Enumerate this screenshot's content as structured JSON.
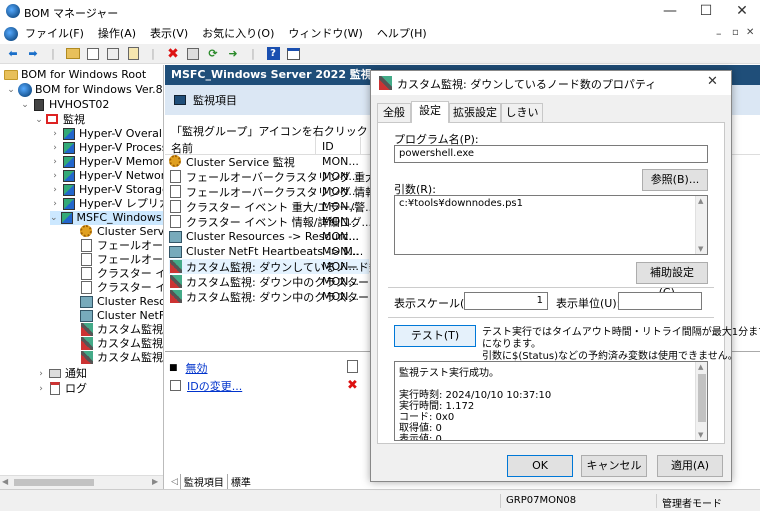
{
  "window": {
    "title": "BOM マネージャー"
  },
  "menubar": [
    "ファイル(F)",
    "操作(A)",
    "表示(V)",
    "お気に入り(O)",
    "ウィンドウ(W)",
    "ヘルプ(H)"
  ],
  "tree": {
    "root": "BOM for Windows Root",
    "version_node": "BOM for Windows Ver.8.0 (ロー",
    "host": "HVHOST02",
    "monitor": "監視",
    "groups": [
      "Hyper-V Overall he",
      "Hyper-V Processo",
      "Hyper-V Memory",
      "Hyper-V Networkin",
      "Hyper-V Storage",
      "Hyper-V レプリカ 監",
      "MSFC_Windows Se"
    ],
    "items": [
      "Cluster Service",
      "フェールオーバーク",
      "フェールオーバーク",
      "クラスター イベント",
      "クラスター イベント",
      "Cluster Resourc",
      "Cluster NetFt H",
      "カスタム監視: ダウ",
      "カスタム監視: ダウ",
      "カスタム監視: ダ"
    ],
    "notify": "通知",
    "log": "ログ"
  },
  "middle": {
    "header": "MSFC_Windows Server 2022  監視",
    "subheader": "監視項目",
    "hint": "「監視グループ」アイコンを右クリックし「新規作成」を選",
    "col_name": "名前",
    "col_id": "ID",
    "rows": [
      {
        "name": "Cluster Service 監視",
        "id": "MON..."
      },
      {
        "name": "フェールオーバークラスタリング 重大...",
        "id": "MON..."
      },
      {
        "name": "フェールオーバークラスタリング 情報...",
        "id": "MON..."
      },
      {
        "name": "クラスター イベント 重大/エラー/警...",
        "id": "MON..."
      },
      {
        "name": "クラスター イベント 情報/詳細ログ...",
        "id": "MON..."
      },
      {
        "name": "Cluster Resources -> Resourc...",
        "id": "MON..."
      },
      {
        "name": "Cluster NetFt Heartbeats -> M...",
        "id": "MON..."
      },
      {
        "name": "カスタム監視: ダウンしているノード数",
        "id": "MON..."
      },
      {
        "name": "カスタム監視: ダウン中のクラスター...",
        "id": "MON..."
      },
      {
        "name": "カスタム監視: ダウン中のクラスター...",
        "id": "MON..."
      }
    ],
    "footer_links": [
      "無効",
      "IDの変更..."
    ],
    "tabs": [
      "監視項目",
      "標準"
    ]
  },
  "dialog": {
    "title": "カスタム監視: ダウンしているノード数のプロパティ",
    "tabs": [
      "全般",
      "設定",
      "拡張設定",
      "しきい値"
    ],
    "active_tab": "設定",
    "program_label": "プログラム名(P):",
    "program_value": "powershell.exe",
    "browse_button": "参照(B)...",
    "args_label": "引数(R):",
    "args_value": "c:¥tools¥downnodes.ps1",
    "aux_button": "補助設定(C)...",
    "scale_label": "表示スケール(S):",
    "scale_value": "1",
    "unit_label": "表示単位(U):",
    "unit_value": "",
    "test_button": "テスト(T)",
    "test_note_1": "テスト実行ではタイムアウト時間・リトライ間隔が最大1分まで",
    "test_note_2": "になります。",
    "test_note_3": "引数に$(Status)などの予約済み変数は使用できません。",
    "result_lines": [
      "監視テスト実行成功。",
      "",
      "実行時刻: 2024/10/10 10:37:10",
      "実行時間: 1.172",
      "コード: 0x0",
      "取得値: 0",
      "表示値: 0"
    ],
    "ok_button": "OK",
    "cancel_button": "キャンセル",
    "apply_button": "適用(A)"
  },
  "status": {
    "group": "GRP07MON08",
    "mode": "管理者モード"
  },
  "colors": {
    "header_bg": "#1f4e79",
    "accent": "#0078d7"
  }
}
